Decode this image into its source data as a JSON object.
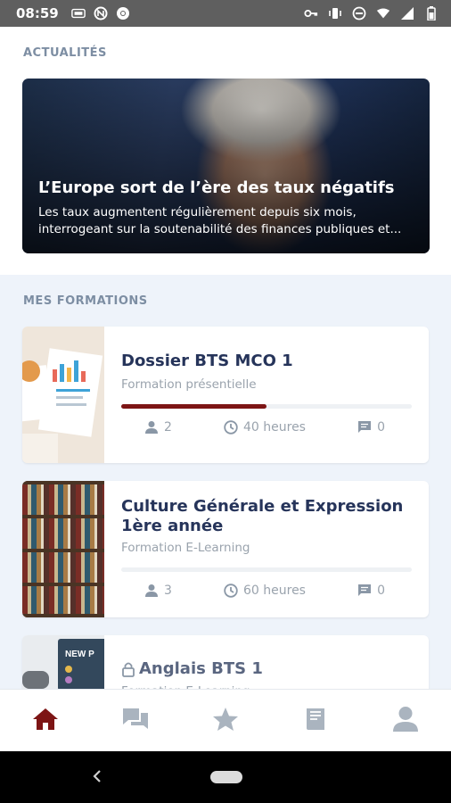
{
  "status_bar": {
    "time": "08:59",
    "left_icons": [
      "sim-icon",
      "notification-icon",
      "chrome-icon"
    ],
    "right_icons": [
      "key-icon",
      "vibrate-icon",
      "dnd-icon",
      "wifi-icon",
      "signal-icon",
      "battery-icon"
    ]
  },
  "news": {
    "section_title": "ACTUALITÉS",
    "article": {
      "headline": "L’Europe sort de l’ère des taux négatifs",
      "summary": "Les taux augmentent régulièrement depuis six mois, interrogeant sur la soutenabilité des finances publiques et..."
    }
  },
  "formations": {
    "section_title": "MES FORMATIONS",
    "courses": [
      {
        "title": "Dossier BTS MCO 1",
        "type": "Formation présentielle",
        "progress": 0.5,
        "participants": "2",
        "hours": "40 heures",
        "comments": "0"
      },
      {
        "title": "Culture Générale et Expression 1ère année",
        "type": "Formation E-Learning",
        "progress": 0,
        "participants": "3",
        "hours": "60 heures",
        "comments": "0"
      },
      {
        "title": "Anglais BTS 1",
        "type": "Formation E-Learning",
        "locked": true
      }
    ]
  },
  "bottom_nav": {
    "items": [
      "home-icon",
      "chat-icon",
      "star-icon",
      "book-icon",
      "profile-icon"
    ],
    "active": "home-icon",
    "active_color": "#7d1515",
    "inactive_color": "#aab4bf"
  }
}
